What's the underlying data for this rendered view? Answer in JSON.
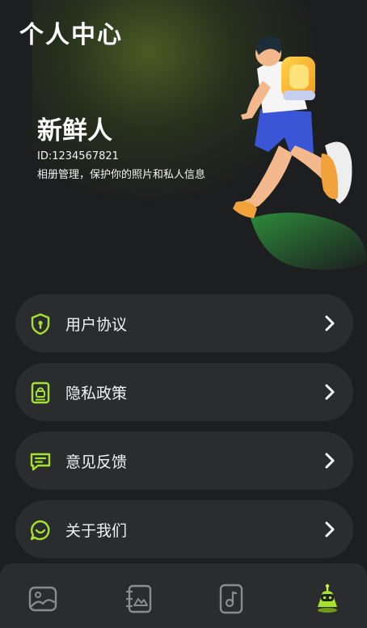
{
  "header": {
    "title": "个人中心"
  },
  "profile": {
    "nickname": "新鲜人",
    "id_text": "ID:1234567821",
    "description": "相册管理，保护你的照片和私人信息"
  },
  "menu": [
    {
      "label": "用户协议",
      "icon": "shield-icon"
    },
    {
      "label": "隐私政策",
      "icon": "document-lock-icon"
    },
    {
      "label": "意见反馈",
      "icon": "message-icon"
    },
    {
      "label": "关于我们",
      "icon": "chat-bubble-icon"
    }
  ],
  "tabbar": {
    "tabs": [
      {
        "name": "album",
        "icon": "image-icon",
        "active": false
      },
      {
        "name": "photo-book",
        "icon": "photo-book-icon",
        "active": false
      },
      {
        "name": "music",
        "icon": "music-icon",
        "active": false
      },
      {
        "name": "me",
        "icon": "robot-icon",
        "active": true
      }
    ]
  },
  "colors": {
    "accent": "#a6e22e",
    "background": "#1c1e1f",
    "card": "#2a2c2e"
  }
}
